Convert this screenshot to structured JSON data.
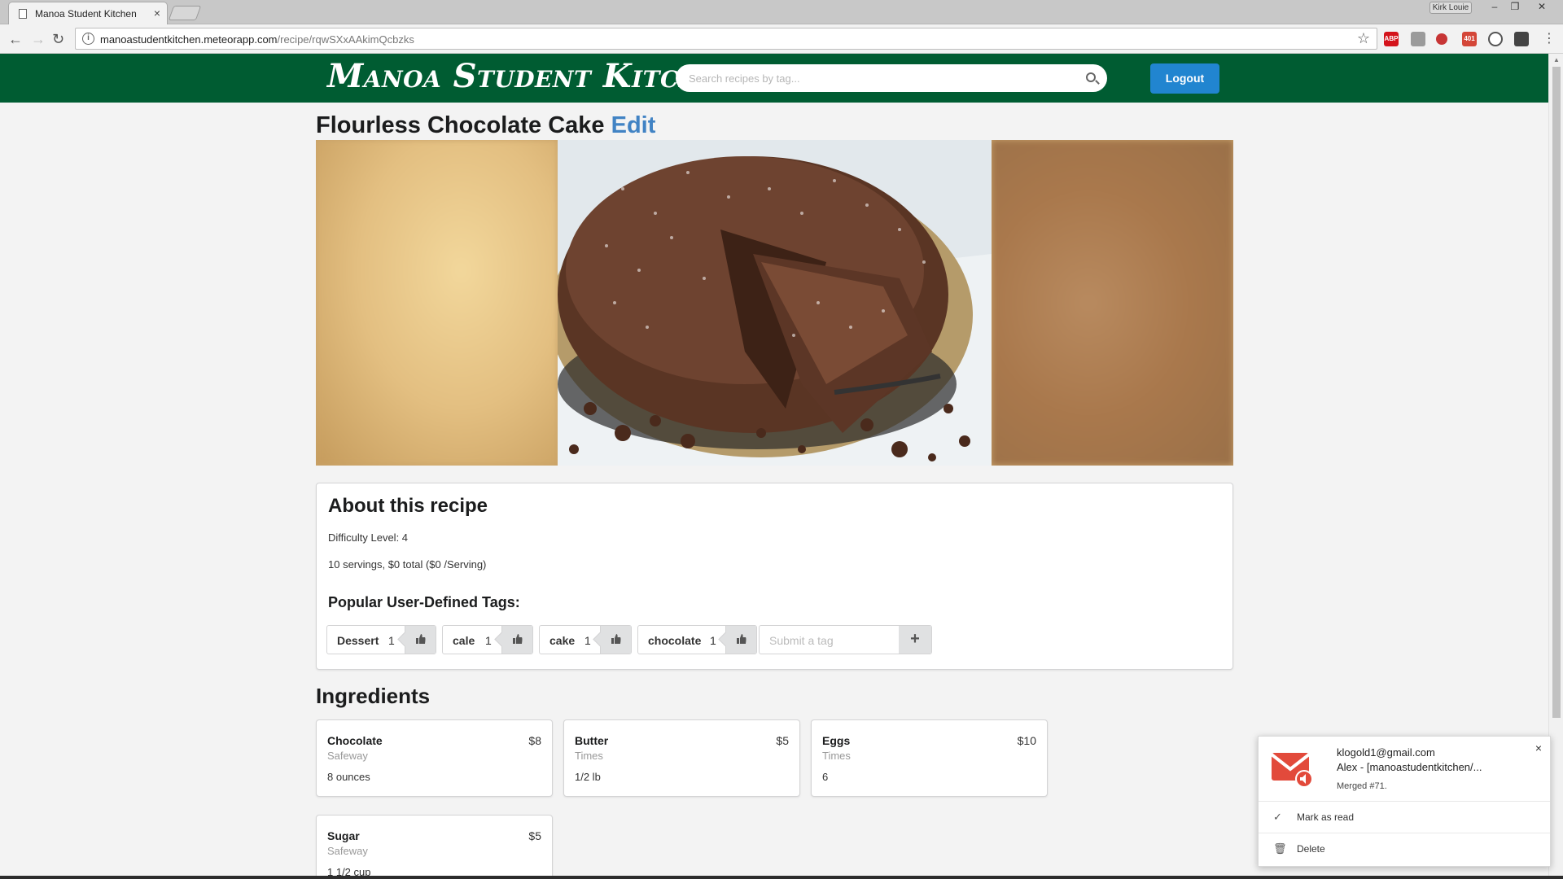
{
  "browser": {
    "tab_title": "Manoa Student Kitchen",
    "tab_close": "×",
    "user": "Kirk Louie",
    "url_host": "manoastudentkitchen.meteorapp.com",
    "url_path": "/recipe/rqwSXxAAkimQcbzks",
    "window_controls": [
      "–",
      "❐",
      "✕"
    ],
    "extensions": [
      {
        "name": "abp-icon",
        "label": "ABP",
        "color": "#d4131b"
      },
      {
        "name": "extension-icon",
        "label": "",
        "color": "#9b9b9b"
      },
      {
        "name": "lastpass-icon",
        "label": "",
        "color": "#c73535"
      },
      {
        "name": "gmail-checker-icon",
        "label": "401",
        "color": "#d44638"
      },
      {
        "name": "sync-icon",
        "label": "",
        "color": "#555555"
      },
      {
        "name": "shield-icon",
        "label": "",
        "color": "#444444"
      }
    ]
  },
  "header": {
    "logo": "Manoa Student Kitchen",
    "search_placeholder": "Search recipes by tag...",
    "logout": "Logout",
    "brand_color": "#005c32",
    "button_color": "#2185d0"
  },
  "recipe": {
    "title": "Flourless Chocolate Cake",
    "edit": "Edit"
  },
  "about": {
    "heading": "About this recipe",
    "difficulty": "Difficulty Level: 4",
    "servings": "10 servings, $0 total ($0 /Serving)",
    "tags_heading": "Popular User-Defined Tags:",
    "tags": [
      {
        "label": "Dessert",
        "count": "1"
      },
      {
        "label": "cale",
        "count": "1"
      },
      {
        "label": "cake",
        "count": "1"
      },
      {
        "label": "chocolate",
        "count": "1"
      }
    ],
    "submit_placeholder": "Submit a tag",
    "plus": "+"
  },
  "ingredients": {
    "heading": "Ingredients",
    "items": [
      {
        "name": "Chocolate",
        "price": "$8",
        "store": "Safeway",
        "qty": "8 ounces"
      },
      {
        "name": "Butter",
        "price": "$5",
        "store": "Times",
        "qty": "1/2 lb"
      },
      {
        "name": "Eggs",
        "price": "$10",
        "store": "Times",
        "qty": "6"
      },
      {
        "name": "Sugar",
        "price": "$5",
        "store": "Safeway",
        "qty": "1 1/2 cup"
      }
    ]
  },
  "notification": {
    "from": "klogold1@gmail.com",
    "subject": "Alex - [manoastudentkitchen/...",
    "body": "Merged #71.",
    "close": "×",
    "actions": [
      {
        "icon": "✓",
        "label": "Mark as read"
      },
      {
        "icon": "🗑",
        "label": "Delete"
      }
    ]
  }
}
